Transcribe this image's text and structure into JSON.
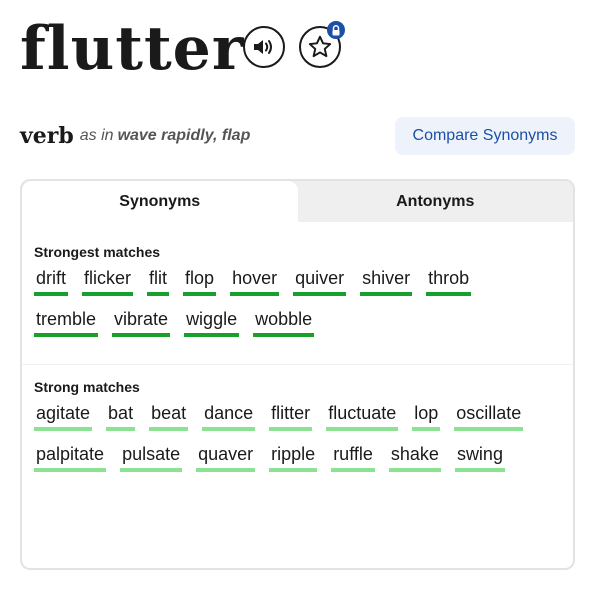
{
  "entry": {
    "word": "flutter"
  },
  "icons": {
    "audio": "speaker-icon",
    "favorite": "star-icon",
    "lock": "lock-icon"
  },
  "sense": {
    "part_of_speech": "verb",
    "as_in": "as in",
    "definition": "wave rapidly, flap"
  },
  "compare_button": "Compare Synonyms",
  "tabs": [
    {
      "label": "Synonyms",
      "active": true
    },
    {
      "label": "Antonyms",
      "active": false
    }
  ],
  "strongest": {
    "title": "Strongest matches",
    "words": [
      "drift",
      "flicker",
      "flit",
      "flop",
      "hover",
      "quiver",
      "shiver",
      "throb",
      "tremble",
      "vibrate",
      "wiggle",
      "wobble"
    ]
  },
  "strong": {
    "title": "Strong matches",
    "words": [
      "agitate",
      "bat",
      "beat",
      "dance",
      "flitter",
      "fluctuate",
      "lop",
      "oscillate",
      "palpitate",
      "pulsate",
      "quaver",
      "ripple",
      "ruffle",
      "shake",
      "swing"
    ]
  },
  "colors": {
    "strongest_underline": "#18a02e",
    "strong_underline": "#8ce292",
    "link_blue": "#1c4fa6",
    "compare_bg": "#eef3fb"
  }
}
